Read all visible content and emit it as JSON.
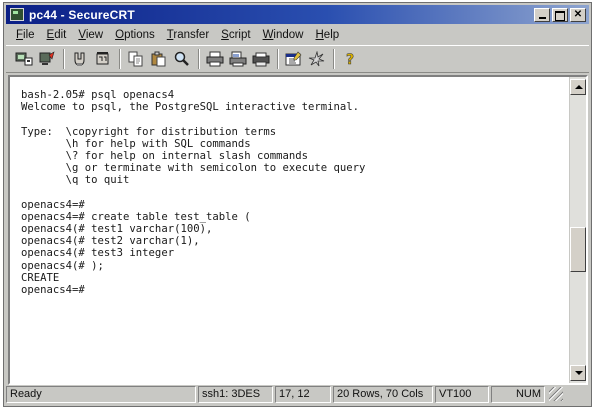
{
  "window": {
    "title": "pc44 - SecureCRT"
  },
  "menubar": {
    "items": [
      {
        "accel": "F",
        "rest": "ile"
      },
      {
        "accel": "E",
        "rest": "dit"
      },
      {
        "accel": "V",
        "rest": "iew"
      },
      {
        "accel": "O",
        "rest": "ptions"
      },
      {
        "accel": "T",
        "rest": "ransfer"
      },
      {
        "accel": "S",
        "rest": "cript"
      },
      {
        "accel": "W",
        "rest": "indow"
      },
      {
        "accel": "H",
        "rest": "elp"
      }
    ]
  },
  "toolbar": {
    "icons": [
      "connect-icon",
      "quick-connect-icon",
      "connect-tab-icon",
      "disconnect-icon",
      "copy-icon",
      "paste-icon",
      "find-icon",
      "print-icon",
      "print-selection-icon",
      "printer-setup-icon",
      "session-options-icon",
      "keymap-editor-icon",
      "help-icon"
    ]
  },
  "terminal": {
    "lines": [
      "bash-2.05# psql openacs4",
      "Welcome to psql, the PostgreSQL interactive terminal.",
      "",
      "Type:  \\copyright for distribution terms",
      "       \\h for help with SQL commands",
      "       \\? for help on internal slash commands",
      "       \\g or terminate with semicolon to execute query",
      "       \\q to quit",
      "",
      "openacs4=#",
      "openacs4=# create table test_table (",
      "openacs4(# test1 varchar(100),",
      "openacs4(# test2 varchar(1),",
      "openacs4(# test3 integer",
      "openacs4(# );",
      "CREATE",
      "openacs4=#"
    ]
  },
  "statusbar": {
    "ready": "Ready",
    "cipher": "ssh1: 3DES",
    "cursor": "17, 12",
    "size": "20 Rows, 70 Cols",
    "emulation": "VT100",
    "numlock": "NUM"
  },
  "colors": {
    "titlebar_start": "#0b1f86",
    "chrome": "#c8c8c4",
    "terminal_bg": "#ffffff",
    "terminal_fg": "#1a1a1a"
  }
}
